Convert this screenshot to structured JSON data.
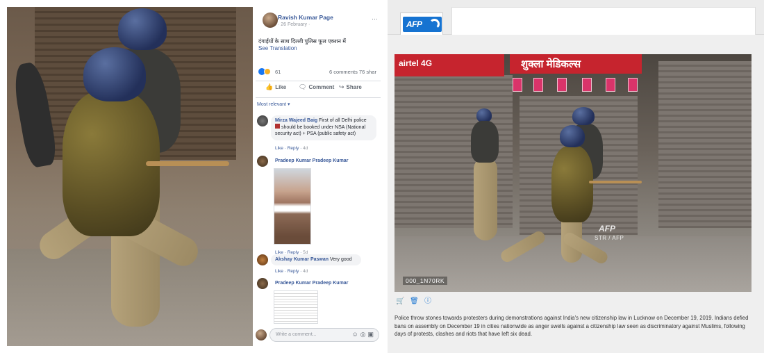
{
  "facebook": {
    "page_name": "Ravish Kumar Page",
    "date": "· 26 February ·",
    "post_text": "दंगाईयों के साथ दिल्ली पुलिस फूल एक्शन में",
    "see_translation": "See Translation",
    "reaction_count": "61",
    "comments_shares": "6 comments 76 shar",
    "actions": {
      "like": "Like",
      "comment": "Comment",
      "share": "Share"
    },
    "most_relevant": "Most relevant ▾",
    "comments": [
      {
        "author": "Mirza Wajeed Baig",
        "text_lines": [
          "First of all Delhi police",
          "should be booked under NSA (National",
          "security act) + PSA (public safety act)"
        ],
        "like": "Like",
        "reply": "Reply",
        "time": "4d"
      },
      {
        "author": "Pradeep Kumar Pradeep Kumar",
        "like": "Like",
        "reply": "Reply",
        "time": "5d"
      },
      {
        "author": "Akshay Kumar Paswan",
        "text": "Very good",
        "like": "Like",
        "reply": "Reply",
        "time": "4d"
      },
      {
        "author": "Pradeep Kumar Pradeep Kumar"
      }
    ],
    "write_placeholder": "Write a comment..."
  },
  "afp": {
    "logo": "AFP",
    "shop_signs": {
      "airtel": "airtel 4G",
      "medical": "शुक्ला मेडिकल्स"
    },
    "watermark_logo": "AFP",
    "watermark_credit": "STR / AFP",
    "image_id": "000_1N70RK",
    "icons": [
      "cart-icon",
      "basket-icon",
      "info-icon"
    ],
    "caption": "Police throw stones towards protesters during demonstrations against India's new citizenship law in Lucknow on December 19, 2019. Indians defied bans on assembly on December 19 in cities nationwide as anger swells against a citizenship law seen as discriminatory against Muslims, following days of protests, clashes and riots that have left six dead."
  },
  "colors": {
    "facebook_blue": "#385898",
    "afp_blue": "#1673d1"
  }
}
